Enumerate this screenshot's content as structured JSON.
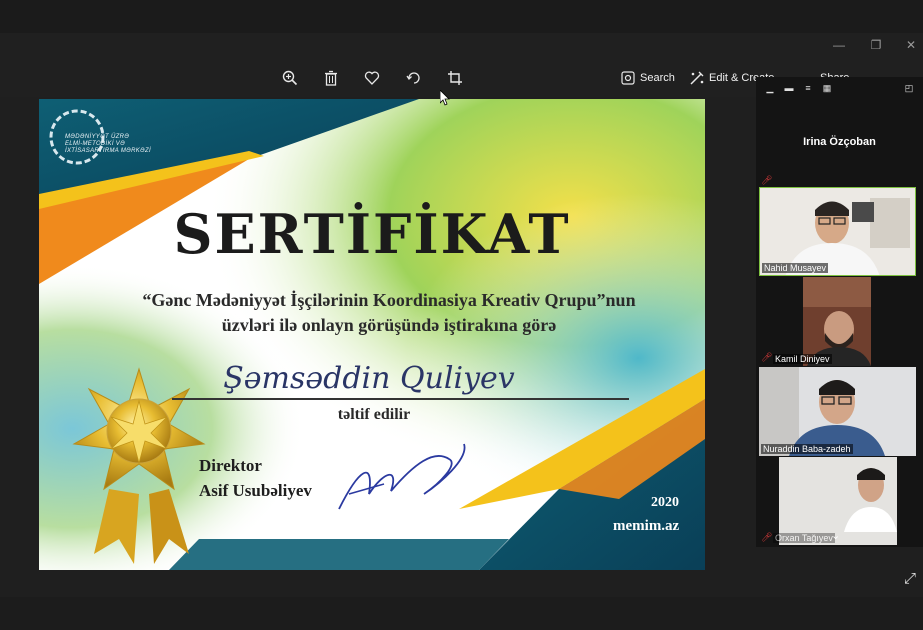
{
  "toolbar": {
    "search_label": "Search",
    "edit_create_label": "Edit & Create",
    "share_label": "Share",
    "icons": [
      "zoom-in-icon",
      "trash-icon",
      "heart-icon",
      "rotate-icon",
      "crop-icon"
    ]
  },
  "window": {
    "minimize": "—",
    "restore": "❐",
    "close": "✕"
  },
  "certificate": {
    "org_logo_text": [
      "MƏDƏNİYYƏT ÜZRƏ",
      "ELMİ-METODİKİ VƏ",
      "İXTİSASARTIRMA MƏRKƏZİ"
    ],
    "title": "SERTİFİKAT",
    "line1": "“Gənc Mədəniyyət İşçilərinin Koordinasiya Kreativ Qrupu”nun",
    "line2": "üzvləri ilə onlayn görüşündə iştirakına görə",
    "recipient": "Şəmsəddin  Quliyev",
    "awarded": "təltif edilir",
    "director_title": "Direktor",
    "director_name": "Asif Usubəliyev",
    "year": "2020",
    "website": "memim.az"
  },
  "meeting": {
    "active_speaker": "Irina Özçoban",
    "participants": [
      {
        "name": "Nahid Musayev",
        "muted": false
      },
      {
        "name": "Kamil Diniyev",
        "muted": true
      },
      {
        "name": "Nuraddin Baba-zadeh",
        "muted": false
      },
      {
        "name": "Orxan Tağıyev",
        "muted": true
      }
    ]
  },
  "colors": {
    "accent_teal": "#0f6f83",
    "accent_orange": "#f08a1c",
    "accent_yellow": "#f4c21b",
    "green_border": "#7ec240",
    "mute_red": "#d63b3b"
  }
}
